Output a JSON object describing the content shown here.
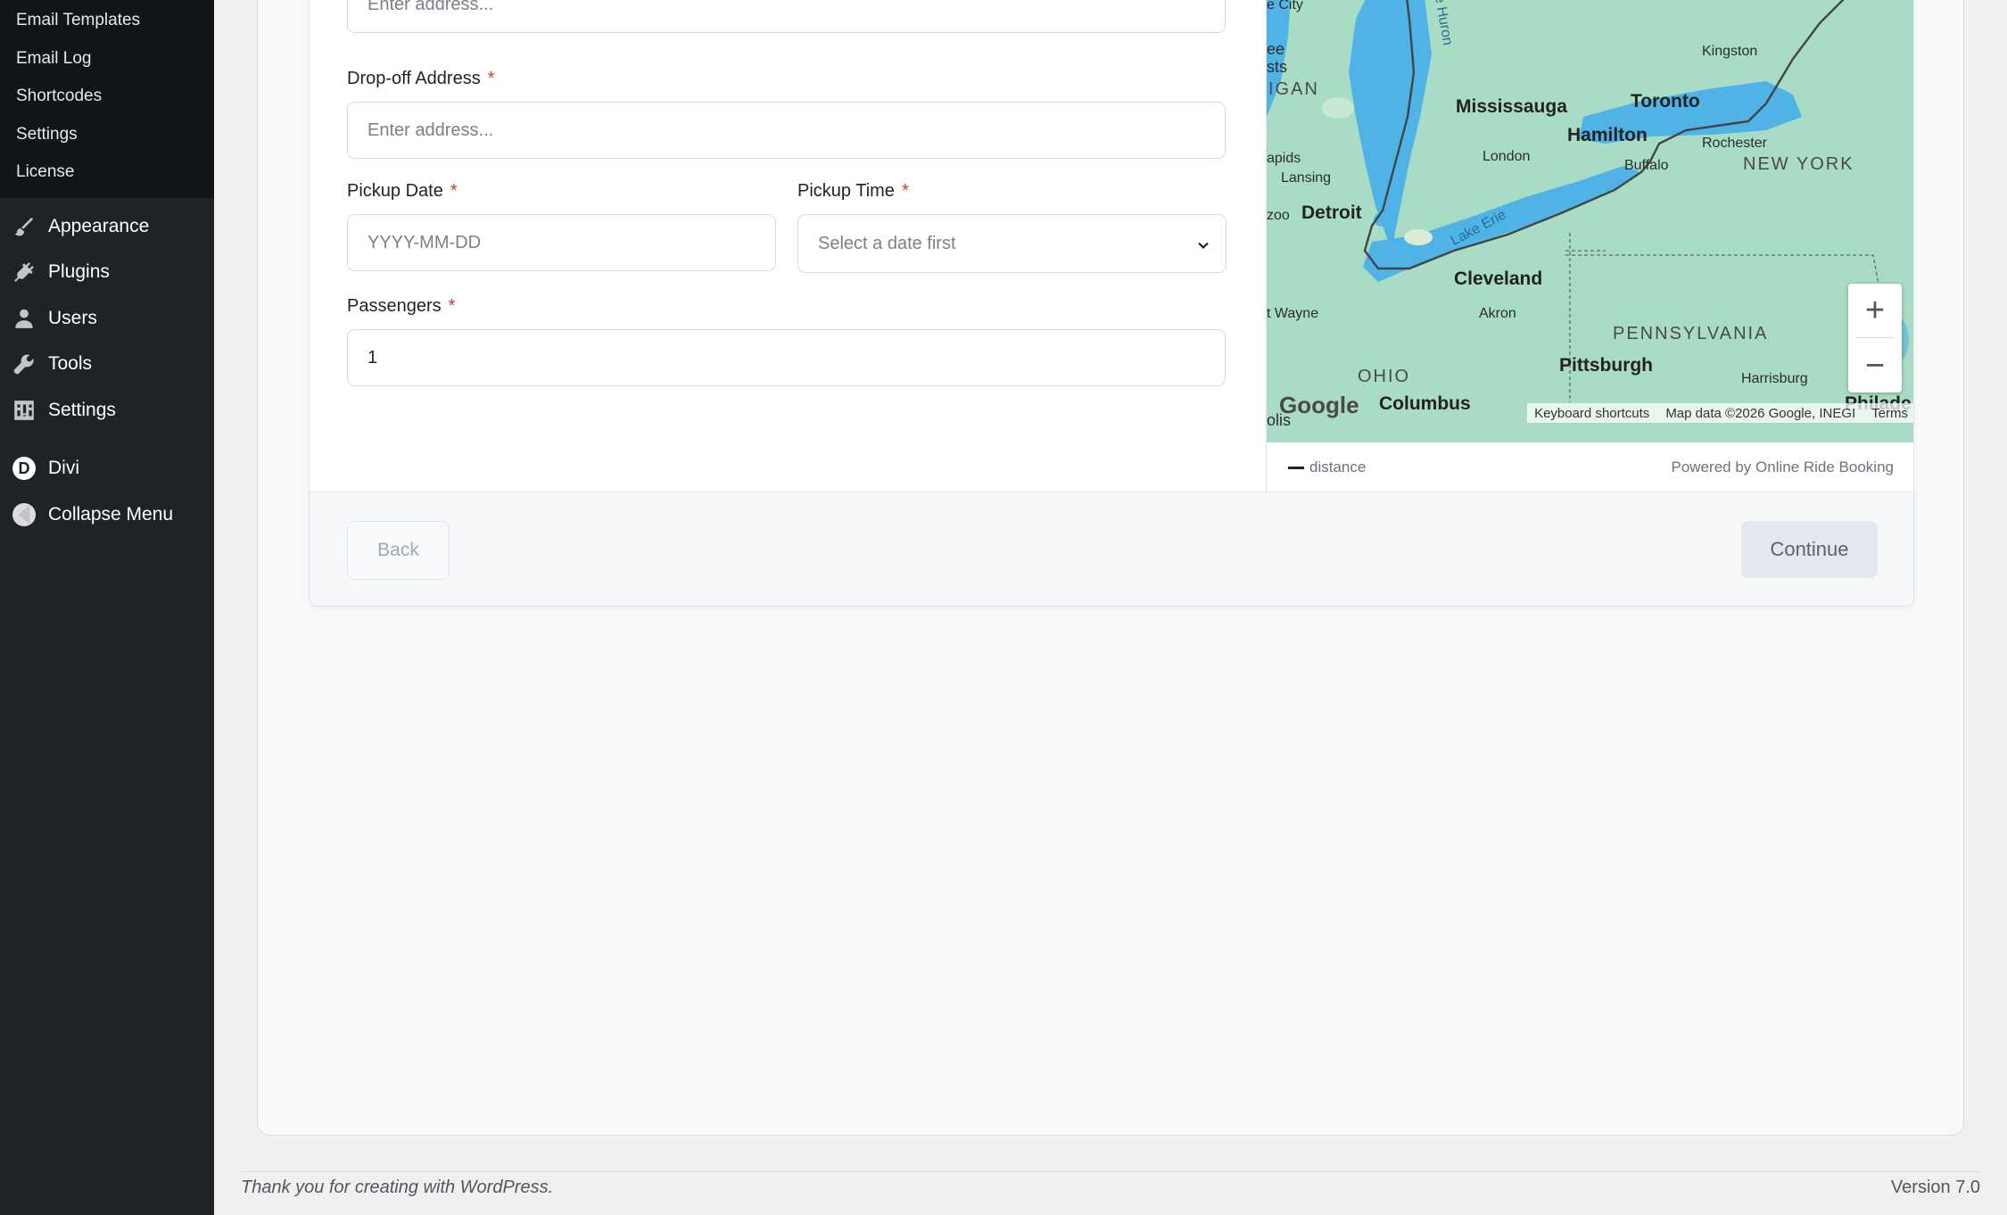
{
  "sidebar": {
    "submenu": [
      {
        "label": "Email Templates"
      },
      {
        "label": "Email Log"
      },
      {
        "label": "Shortcodes"
      },
      {
        "label": "Settings"
      },
      {
        "label": "License"
      }
    ],
    "menu": [
      {
        "label": "Appearance",
        "icon": "paintbrush-icon"
      },
      {
        "label": "Plugins",
        "icon": "plugin-icon"
      },
      {
        "label": "Users",
        "icon": "users-icon"
      },
      {
        "label": "Tools",
        "icon": "wrench-icon"
      },
      {
        "label": "Settings",
        "icon": "settings-icon"
      }
    ],
    "divi": {
      "label": "Divi",
      "badge": "D"
    },
    "collapse": {
      "label": "Collapse Menu"
    }
  },
  "form": {
    "pickup_address": {
      "placeholder": "Enter address..."
    },
    "dropoff_address": {
      "label": "Drop-off Address",
      "required": "*",
      "placeholder": "Enter address..."
    },
    "pickup_date": {
      "label": "Pickup Date",
      "required": "*",
      "placeholder": "YYYY-MM-DD"
    },
    "pickup_time": {
      "label": "Pickup Time",
      "required": "*",
      "selected": "Select a date first"
    },
    "passengers": {
      "label": "Passengers",
      "required": "*",
      "value": "1"
    }
  },
  "map": {
    "labels": {
      "e_city": "e City",
      "ee": "ee",
      "sts": "sts",
      "igan": "IGAN",
      "kingston": "Kingston",
      "mississauga": "Mississauga",
      "toronto": "Toronto",
      "hamilton": "Hamilton",
      "rochester": "Rochester",
      "london": "London",
      "buffalo": "Buffalo",
      "new_york": "NEW YORK",
      "apids": "apids",
      "lansing": "Lansing",
      "zoo": "zoo",
      "detroit": "Detroit",
      "lake_erie": "Lake Erie",
      "cleveland": "Cleveland",
      "t_wayne": "t Wayne",
      "akron": "Akron",
      "pennsylvania": "PENNSYLVANIA",
      "ohio": "OHIO",
      "pittsburgh": "Pittsburgh",
      "harrisburg": "Harrisburg",
      "columbus": "Columbus",
      "philad": "Philade",
      "olis": "olis",
      "lake_huron": "Lake Huron"
    },
    "zoom_in": "+",
    "zoom_out": "−",
    "google": "Google",
    "keyboard_shortcuts": "Keyboard shortcuts",
    "map_data": "Map data ©2026 Google, INEGI",
    "terms": "Terms",
    "legend_distance": "distance",
    "powered_by": "Powered by Online Ride Booking"
  },
  "actions": {
    "back": "Back",
    "continue": "Continue"
  },
  "footer": {
    "thanks": "Thank you for creating with WordPress.",
    "version": "Version 7.0"
  },
  "colors": {
    "sidebar_bg": "#1d2327",
    "submenu_bg": "#101517",
    "required": "#d63638",
    "map_land": "#a9dcc4",
    "map_water": "#4fb3e6"
  }
}
